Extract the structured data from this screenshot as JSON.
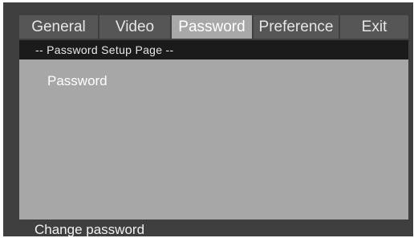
{
  "tabs": [
    {
      "label": "General"
    },
    {
      "label": "Video"
    },
    {
      "label": "Password"
    },
    {
      "label": "Preference"
    },
    {
      "label": "Exit"
    }
  ],
  "active_tab": "Password",
  "panel": {
    "header": "-- Password Setup Page --",
    "items": [
      {
        "label": "Password"
      }
    ]
  },
  "status": {
    "text": "Change password"
  },
  "colors": {
    "frame": "#3f3f3f",
    "tab_inactive": "#565656",
    "tab_active": "#a8a8a8",
    "panel_bg": "#a7a7a7",
    "header_bg": "#1b1b1b"
  }
}
